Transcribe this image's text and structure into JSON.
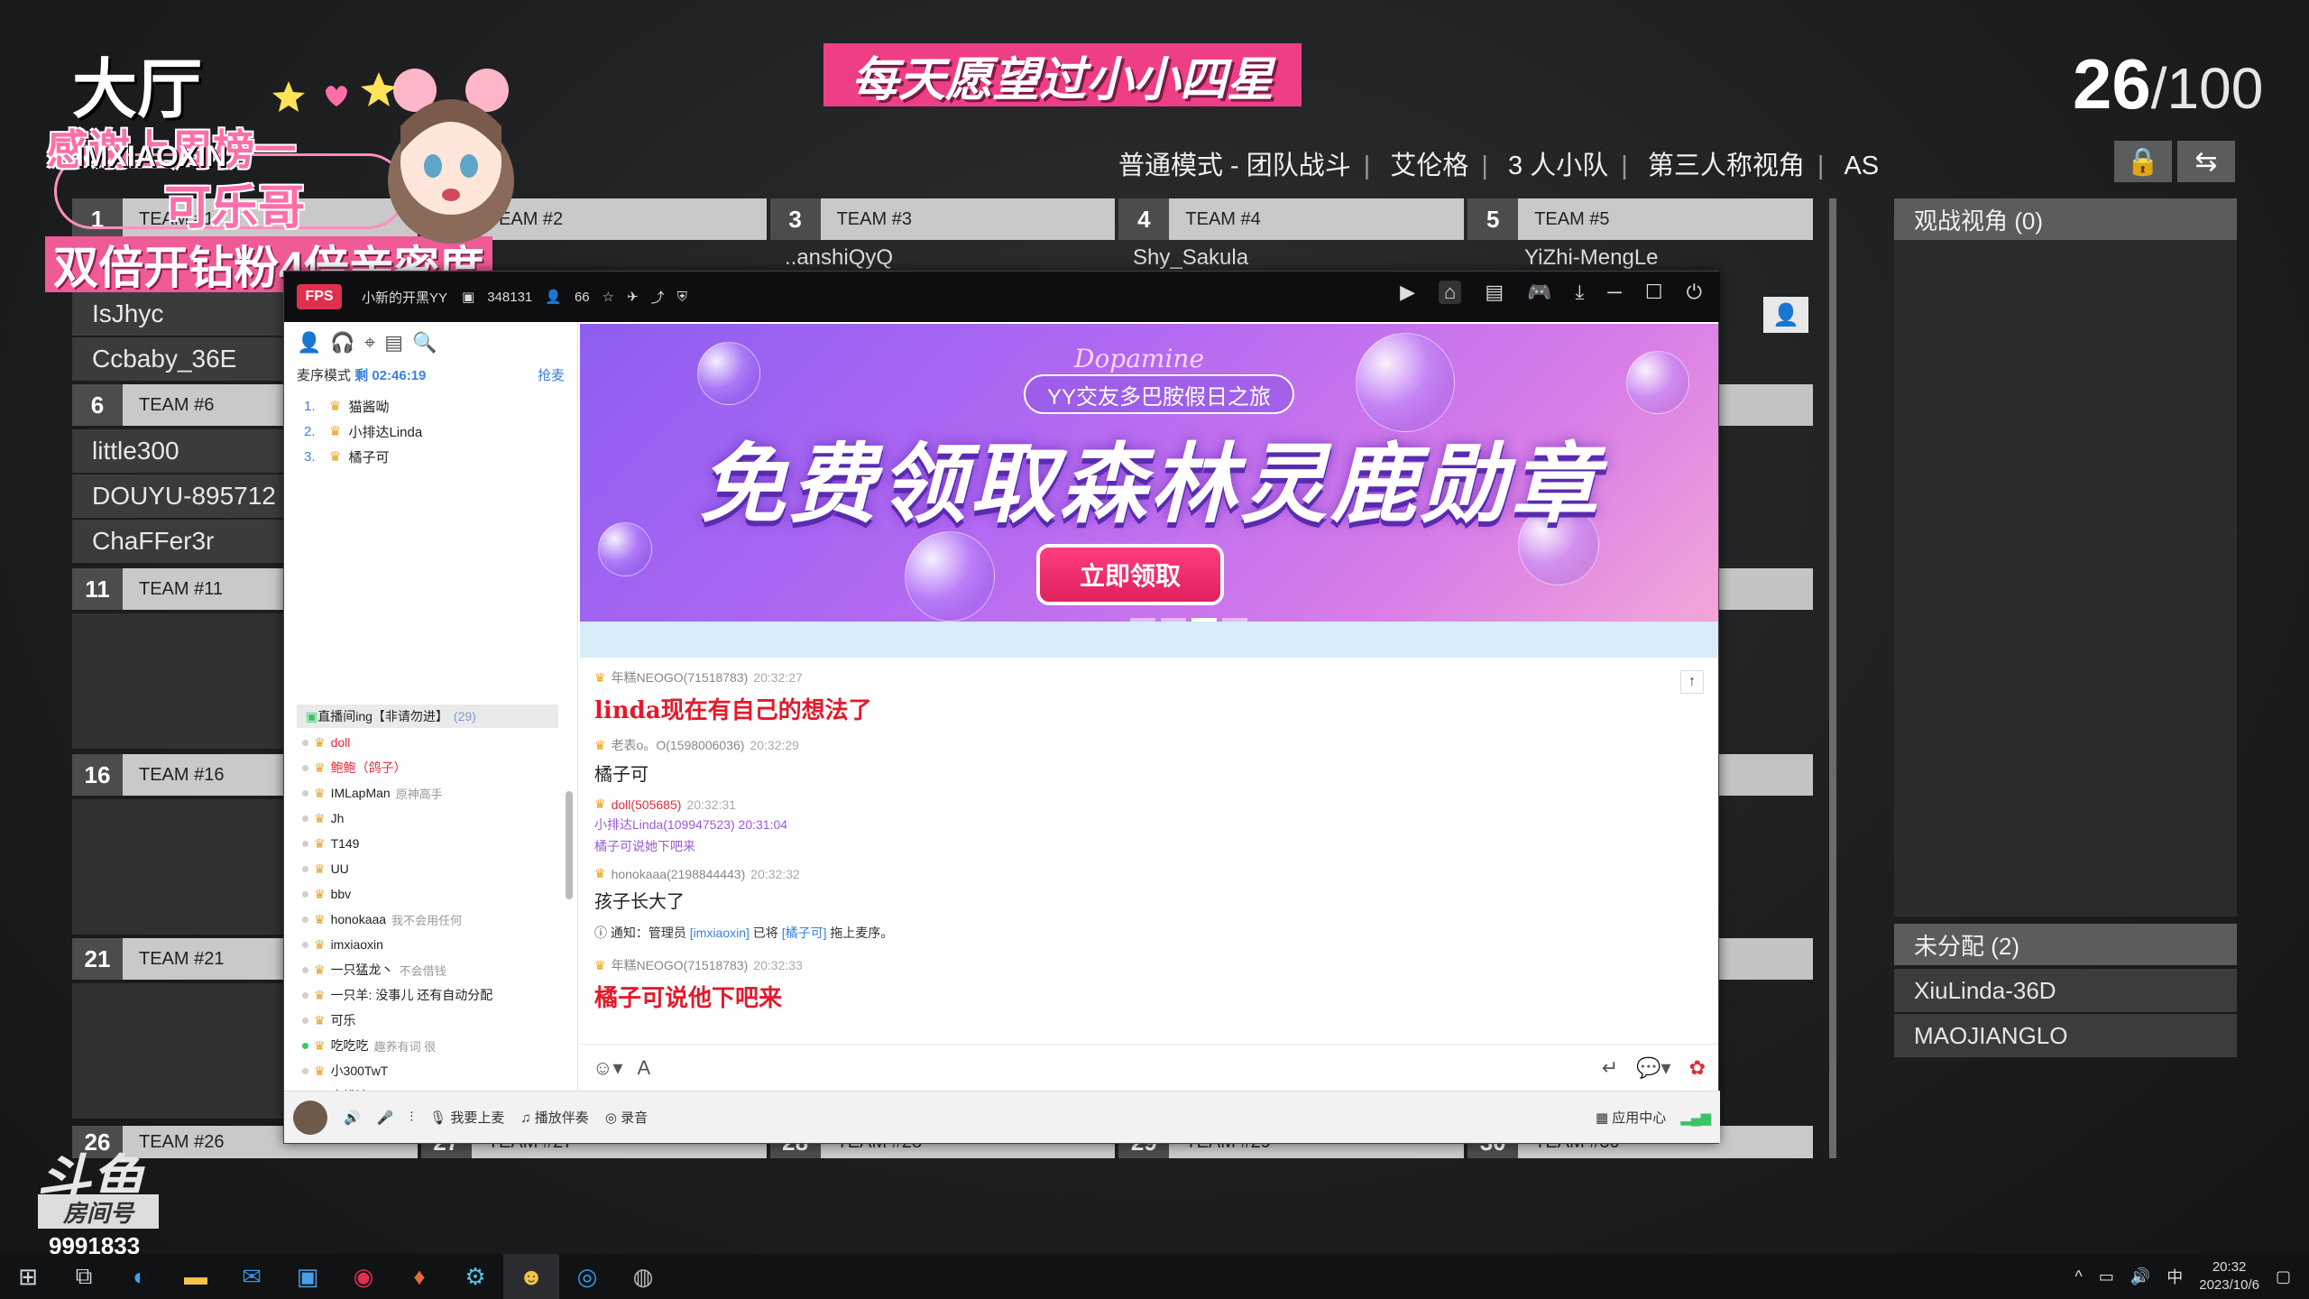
{
  "hall": {
    "title": "大厅",
    "banner": "每天愿望过小小四星",
    "count": "26",
    "max": "/100"
  },
  "mode": [
    "普通模式 - 团队战斗",
    "艾伦格",
    "3 人小队",
    "第三人称视角",
    "AS"
  ],
  "overlay": {
    "thanks": "感谢上周榜一",
    "id": "IMXIAOXIN",
    "cola": "可乐哥",
    "double": "双倍开钻粉4倍亲密度"
  },
  "teams": {
    "row1": [
      {
        "num": "1",
        "name": "TEAM #1"
      },
      {
        "num": "2",
        "name": "TEAM #2"
      },
      {
        "num": "3",
        "name": "TEAM #3"
      },
      {
        "num": "4",
        "name": "TEAM #4"
      },
      {
        "num": "5",
        "name": "TEAM #5"
      }
    ],
    "partial_names": [
      "..anshiQyQ",
      "Shy_Sakula",
      "YiZhi-MengLe"
    ],
    "team1_players": [
      "IsJhyc",
      "Ccbaby_36E"
    ],
    "team6": {
      "num": "6",
      "name": "TEAM #6"
    },
    "team6_players": [
      "little300",
      "DOUYU-895712",
      "ChaFFer3r"
    ],
    "team11": {
      "num": "11",
      "name": "TEAM #11"
    },
    "team16": {
      "num": "16",
      "name": "TEAM #16"
    },
    "team21": {
      "num": "21",
      "name": "TEAM #21"
    },
    "row26": [
      {
        "num": "26",
        "name": "TEAM #26"
      },
      {
        "num": "27",
        "name": "TEAM #27"
      },
      {
        "num": "28",
        "name": "TEAM #28"
      },
      {
        "num": "29",
        "name": "TEAM #29"
      },
      {
        "num": "30",
        "name": "TEAM #30"
      }
    ]
  },
  "spectate": {
    "header": "观战视角 (0)",
    "unassigned": "未分配 (2)",
    "players": [
      "XiuLinda-36D",
      "MAOJIANGLO"
    ]
  },
  "yy": {
    "logo": "FPS",
    "channel": "小新的开黑YY",
    "id": "348131",
    "users": "66",
    "mic_mode": "麦序模式",
    "remaining": "剩 02:46:19",
    "grab": "抢麦",
    "queue": [
      {
        "n": "1.",
        "name": "猫酱呦"
      },
      {
        "n": "2.",
        "name": "小排达Linda"
      },
      {
        "n": "3.",
        "name": "橘子可"
      }
    ],
    "room": "直播间ing【非请勿进】",
    "room_count": "(29)",
    "members": [
      {
        "name": "doll",
        "note": "",
        "red": true
      },
      {
        "name": "鲍鲍（鸽子）",
        "note": "",
        "red": true
      },
      {
        "name": "IMLapMan",
        "note": "原神高手",
        "red": false
      },
      {
        "name": "Jh",
        "note": "",
        "red": false
      },
      {
        "name": "T149",
        "note": "",
        "red": false
      },
      {
        "name": "UU",
        "note": "",
        "red": false
      },
      {
        "name": "bbv",
        "note": "",
        "red": false
      },
      {
        "name": "honokaaa",
        "note": "我不会用任何",
        "red": false
      },
      {
        "name": "imxiaoxin",
        "note": "",
        "red": false
      },
      {
        "name": "一只猛龙丶",
        "note": "不会借钱",
        "red": false
      },
      {
        "name": "一只羊: 没事儿 还有自动分配",
        "note": "",
        "red": false
      },
      {
        "name": "可乐",
        "note": "",
        "red": false
      },
      {
        "name": "吃吃吃",
        "note": "趣养有词 很",
        "red": false,
        "on": true
      },
      {
        "name": "小300TwT",
        "note": "",
        "red": false
      },
      {
        "name": "小排达Linda",
        "note": "不借钱",
        "red": false
      }
    ],
    "promo": {
      "brand": "Dopamine",
      "sub": "YY交友多巴胺假日之旅",
      "title": "免费领取森林灵鹿勋章",
      "button": "立即领取"
    },
    "chat": [
      {
        "user": "年糕NEOGO(71518783)",
        "time": "20:32:27",
        "body": "linda现在有自己的想法了",
        "big": true
      },
      {
        "user": "老表o。O(1598006036)",
        "time": "20:32:29",
        "body": "橘子可",
        "big": false
      },
      {
        "user": "doll(505685)",
        "time": "20:32:31",
        "quote_user": "小排达Linda(109947523) 20:31:04",
        "quote": "橘子可说她下吧来"
      },
      {
        "user": "honokaaa(2198844443)",
        "time": "20:32:32",
        "body": "孩子长大了",
        "big": false
      }
    ],
    "notice": {
      "prefix": "通知：管理员 ",
      "admin": "[imxiaoxin]",
      "mid": " 已将 ",
      "target": "[橘子可]",
      "suffix": " 拖上麦序。"
    },
    "last": {
      "user": "年糕NEOGO(71518783)",
      "time": "20:32:33",
      "body": "橘子可说他下吧来"
    },
    "bottom": {
      "mic": "我要上麦",
      "music": "播放伴奏",
      "record": "录音",
      "apps": "应用中心"
    }
  },
  "douyu": {
    "logo": "斗鱼",
    "room_label": "房间号",
    "room_num": "9991833"
  },
  "taskbar": {
    "time": "20:32",
    "date": "2023/10/6",
    "ime": "中"
  }
}
